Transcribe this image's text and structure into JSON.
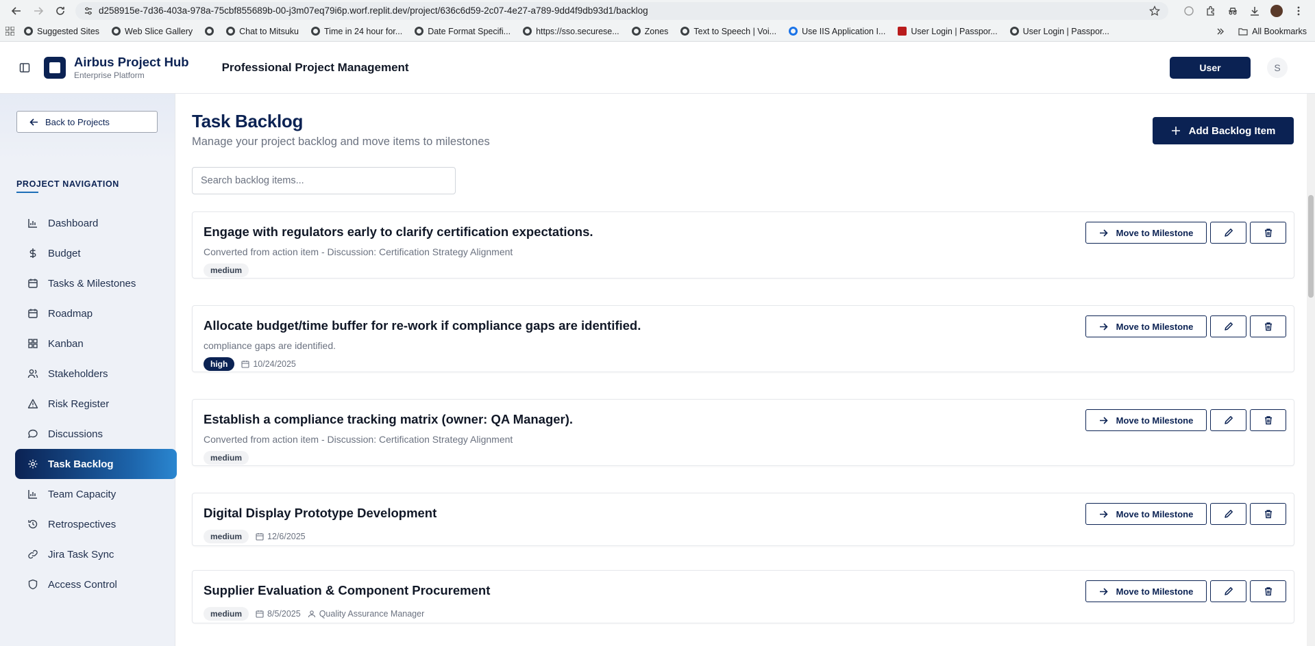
{
  "browser": {
    "url": "d258915e-7d36-403a-978a-75cbf855689b-00-j3m07eq79i6p.worf.replit.dev/project/636c6d59-2c07-4e27-a789-9dd4f9db93d1/backlog",
    "bookmarks": [
      "Suggested Sites",
      "Web Slice Gallery",
      "",
      "Chat to Mitsuku",
      "Time in 24 hour for...",
      "Date Format Specifi...",
      "https://sso.securese...",
      "Zones",
      "Text to Speech | Voi...",
      "Use IIS Application I...",
      "User Login | Passpor...",
      "User Login | Passpor..."
    ],
    "all_bookmarks": "All Bookmarks"
  },
  "header": {
    "brand_title": "Airbus Project Hub",
    "brand_subtitle": "Enterprise Platform",
    "title": "Professional Project Management",
    "user_button": "User",
    "avatar_initial": "S"
  },
  "sidebar": {
    "back_label": "Back to Projects",
    "heading": "PROJECT NAVIGATION",
    "items": [
      {
        "label": "Dashboard",
        "icon": "chart-icon"
      },
      {
        "label": "Budget",
        "icon": "dollar-icon"
      },
      {
        "label": "Tasks & Milestones",
        "icon": "calendar-icon"
      },
      {
        "label": "Roadmap",
        "icon": "calendar-icon"
      },
      {
        "label": "Kanban",
        "icon": "grid-icon"
      },
      {
        "label": "Stakeholders",
        "icon": "users-icon"
      },
      {
        "label": "Risk Register",
        "icon": "warning-icon"
      },
      {
        "label": "Discussions",
        "icon": "message-icon"
      },
      {
        "label": "Task Backlog",
        "icon": "gear-icon",
        "active": true
      },
      {
        "label": "Team Capacity",
        "icon": "chart-icon"
      },
      {
        "label": "Retrospectives",
        "icon": "history-icon"
      },
      {
        "label": "Jira Task Sync",
        "icon": "link-icon"
      },
      {
        "label": "Access Control",
        "icon": "shield-icon"
      }
    ]
  },
  "main": {
    "title": "Task Backlog",
    "subtitle": "Manage your project backlog and move items to milestones",
    "add_button": "Add Backlog Item",
    "search_placeholder": "Search backlog items...",
    "move_label": "Move to Milestone",
    "items": [
      {
        "title": "Engage with regulators early to clarify certification expectations.",
        "description": "Converted from action item - Discussion: Certification Strategy Alignment",
        "priority": "medium",
        "date": "",
        "owner": ""
      },
      {
        "title": "Allocate budget/time buffer for re-work if compliance gaps are identified.",
        "description": "compliance gaps are identified.",
        "priority": "high",
        "date": "10/24/2025",
        "owner": ""
      },
      {
        "title": "Establish a compliance tracking matrix (owner: QA Manager).",
        "description": "Converted from action item - Discussion: Certification Strategy Alignment",
        "priority": "medium",
        "date": "",
        "owner": ""
      },
      {
        "title": "Digital Display Prototype Development",
        "description": "",
        "priority": "medium",
        "date": "12/6/2025",
        "owner": ""
      },
      {
        "title": "Supplier Evaluation & Component Procurement",
        "description": "",
        "priority": "medium",
        "date": "8/5/2025",
        "owner": "Quality Assurance Manager"
      }
    ]
  }
}
